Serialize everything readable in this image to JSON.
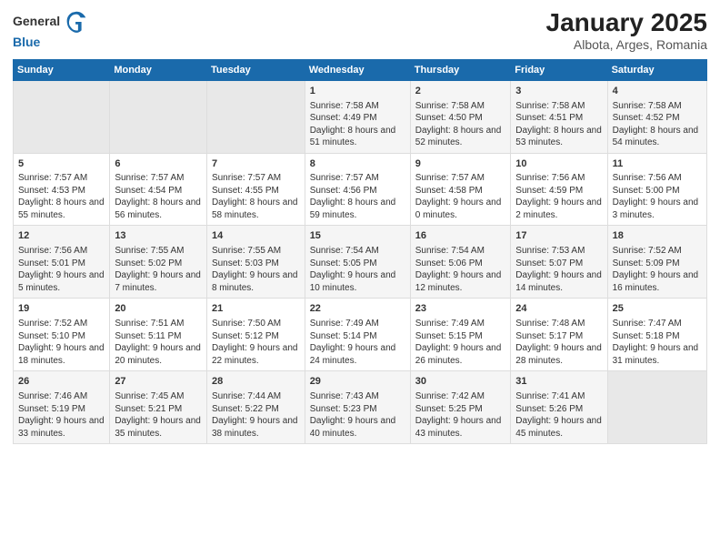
{
  "header": {
    "logo_general": "General",
    "logo_blue": "Blue",
    "title": "January 2025",
    "subtitle": "Albota, Arges, Romania"
  },
  "days_of_week": [
    "Sunday",
    "Monday",
    "Tuesday",
    "Wednesday",
    "Thursday",
    "Friday",
    "Saturday"
  ],
  "weeks": [
    {
      "cells": [
        {
          "empty": true
        },
        {
          "empty": true
        },
        {
          "empty": true
        },
        {
          "day": 1,
          "sunrise": "7:58 AM",
          "sunset": "4:49 PM",
          "daylight": "8 hours and 51 minutes."
        },
        {
          "day": 2,
          "sunrise": "7:58 AM",
          "sunset": "4:50 PM",
          "daylight": "8 hours and 52 minutes."
        },
        {
          "day": 3,
          "sunrise": "7:58 AM",
          "sunset": "4:51 PM",
          "daylight": "8 hours and 53 minutes."
        },
        {
          "day": 4,
          "sunrise": "7:58 AM",
          "sunset": "4:52 PM",
          "daylight": "8 hours and 54 minutes."
        }
      ]
    },
    {
      "cells": [
        {
          "day": 5,
          "sunrise": "7:57 AM",
          "sunset": "4:53 PM",
          "daylight": "8 hours and 55 minutes."
        },
        {
          "day": 6,
          "sunrise": "7:57 AM",
          "sunset": "4:54 PM",
          "daylight": "8 hours and 56 minutes."
        },
        {
          "day": 7,
          "sunrise": "7:57 AM",
          "sunset": "4:55 PM",
          "daylight": "8 hours and 58 minutes."
        },
        {
          "day": 8,
          "sunrise": "7:57 AM",
          "sunset": "4:56 PM",
          "daylight": "8 hours and 59 minutes."
        },
        {
          "day": 9,
          "sunrise": "7:57 AM",
          "sunset": "4:58 PM",
          "daylight": "9 hours and 0 minutes."
        },
        {
          "day": 10,
          "sunrise": "7:56 AM",
          "sunset": "4:59 PM",
          "daylight": "9 hours and 2 minutes."
        },
        {
          "day": 11,
          "sunrise": "7:56 AM",
          "sunset": "5:00 PM",
          "daylight": "9 hours and 3 minutes."
        }
      ]
    },
    {
      "cells": [
        {
          "day": 12,
          "sunrise": "7:56 AM",
          "sunset": "5:01 PM",
          "daylight": "9 hours and 5 minutes."
        },
        {
          "day": 13,
          "sunrise": "7:55 AM",
          "sunset": "5:02 PM",
          "daylight": "9 hours and 7 minutes."
        },
        {
          "day": 14,
          "sunrise": "7:55 AM",
          "sunset": "5:03 PM",
          "daylight": "9 hours and 8 minutes."
        },
        {
          "day": 15,
          "sunrise": "7:54 AM",
          "sunset": "5:05 PM",
          "daylight": "9 hours and 10 minutes."
        },
        {
          "day": 16,
          "sunrise": "7:54 AM",
          "sunset": "5:06 PM",
          "daylight": "9 hours and 12 minutes."
        },
        {
          "day": 17,
          "sunrise": "7:53 AM",
          "sunset": "5:07 PM",
          "daylight": "9 hours and 14 minutes."
        },
        {
          "day": 18,
          "sunrise": "7:52 AM",
          "sunset": "5:09 PM",
          "daylight": "9 hours and 16 minutes."
        }
      ]
    },
    {
      "cells": [
        {
          "day": 19,
          "sunrise": "7:52 AM",
          "sunset": "5:10 PM",
          "daylight": "9 hours and 18 minutes."
        },
        {
          "day": 20,
          "sunrise": "7:51 AM",
          "sunset": "5:11 PM",
          "daylight": "9 hours and 20 minutes."
        },
        {
          "day": 21,
          "sunrise": "7:50 AM",
          "sunset": "5:12 PM",
          "daylight": "9 hours and 22 minutes."
        },
        {
          "day": 22,
          "sunrise": "7:49 AM",
          "sunset": "5:14 PM",
          "daylight": "9 hours and 24 minutes."
        },
        {
          "day": 23,
          "sunrise": "7:49 AM",
          "sunset": "5:15 PM",
          "daylight": "9 hours and 26 minutes."
        },
        {
          "day": 24,
          "sunrise": "7:48 AM",
          "sunset": "5:17 PM",
          "daylight": "9 hours and 28 minutes."
        },
        {
          "day": 25,
          "sunrise": "7:47 AM",
          "sunset": "5:18 PM",
          "daylight": "9 hours and 31 minutes."
        }
      ]
    },
    {
      "cells": [
        {
          "day": 26,
          "sunrise": "7:46 AM",
          "sunset": "5:19 PM",
          "daylight": "9 hours and 33 minutes."
        },
        {
          "day": 27,
          "sunrise": "7:45 AM",
          "sunset": "5:21 PM",
          "daylight": "9 hours and 35 minutes."
        },
        {
          "day": 28,
          "sunrise": "7:44 AM",
          "sunset": "5:22 PM",
          "daylight": "9 hours and 38 minutes."
        },
        {
          "day": 29,
          "sunrise": "7:43 AM",
          "sunset": "5:23 PM",
          "daylight": "9 hours and 40 minutes."
        },
        {
          "day": 30,
          "sunrise": "7:42 AM",
          "sunset": "5:25 PM",
          "daylight": "9 hours and 43 minutes."
        },
        {
          "day": 31,
          "sunrise": "7:41 AM",
          "sunset": "5:26 PM",
          "daylight": "9 hours and 45 minutes."
        },
        {
          "empty": true
        }
      ]
    }
  ]
}
